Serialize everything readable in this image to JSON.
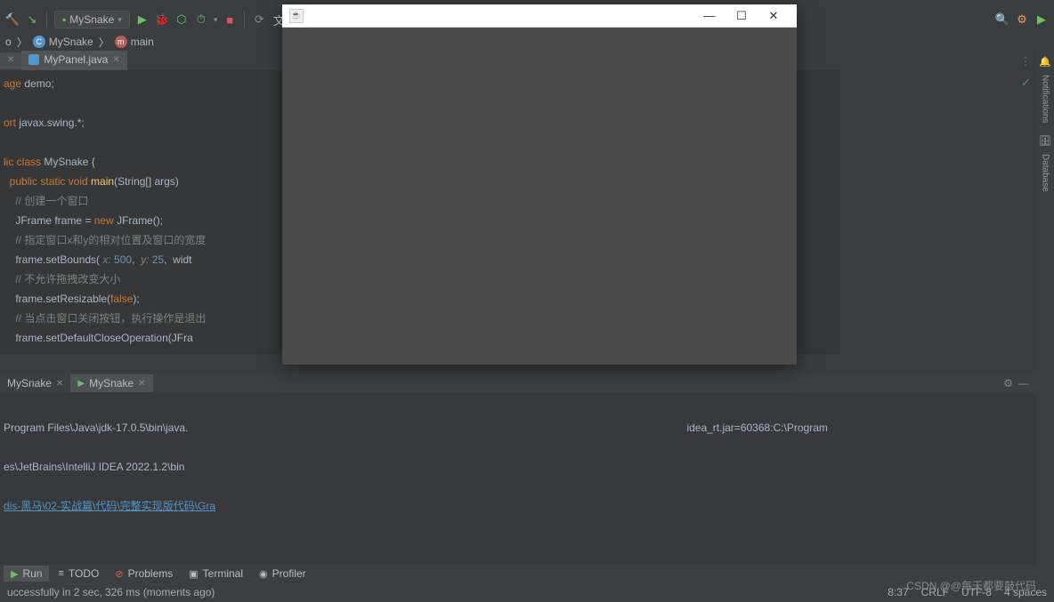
{
  "toolbar": {
    "run_config": "MySnake"
  },
  "breadcrumb": {
    "item1": "o",
    "item2": "MySnake",
    "item3": "main"
  },
  "tabs": {
    "file1": "MyPanel.java"
  },
  "code": {
    "l1a": "age ",
    "l1b": "demo",
    "l1c": ";",
    "l2a": "ort ",
    "l2b": "javax.swing.*",
    "l2c": ";",
    "l3a": "lic class ",
    "l3b": "MySnake ",
    "l3c": "{",
    "l4a": "  public static void ",
    "l4b": "main",
    "l4c": "(",
    "l4d": "String",
    "l4e": "[] ",
    "l4f": "args",
    "l4g": ")",
    "l5": "    // 创建一个窗口",
    "l6a": "    JFrame ",
    "l6b": "frame ",
    "l6c": "= ",
    "l6d": "new ",
    "l6e": "JFrame",
    "l6f": "();",
    "l7": "    // 指定窗口x和y的相对位置及窗口的宽度",
    "l8a": "    frame",
    "l8b": ".setBounds( ",
    "l8c": "x: ",
    "l8d": "500",
    "l8e": ",  ",
    "l8f": "y: ",
    "l8g": "25",
    "l8h": ",  ",
    "l8i": "widt",
    "l9": "    // 不允许拖拽改变大小",
    "l10a": "    frame",
    "l10b": ".setResizable(",
    "l10c": "false",
    "l10d": ");",
    "l11": "    // 当点击窗口关闭按钮，执行操作是退出",
    "l12a": "    frame",
    "l12b": ".setDefaultCloseOperation(JFra"
  },
  "run_tabs": {
    "t1": "MySnake",
    "t2": "MySnake"
  },
  "run_output": {
    "line1a": "Program Files\\Java\\jdk-17.0.5\\bin\\java.",
    "line1b": "idea_rt.jar=60368:C:\\Program",
    "line2": "es\\JetBrains\\IntelliJ IDEA 2022.1.2\\bin",
    "line3": "dis-黑马\\02-实战篇\\代码\\完整实现版代码\\Gra"
  },
  "bottom_tabs": {
    "run": "Run",
    "todo": "TODO",
    "problems": "Problems",
    "terminal": "Terminal",
    "profiler": "Profiler"
  },
  "status": {
    "left": "uccessfully in 2 sec, 326 ms (moments ago)",
    "pos": "8:37",
    "eol": "CRLF",
    "enc": "UTF-8",
    "indent": "4 spaces"
  },
  "sidebar": {
    "notifications": "Notifications",
    "database": "Database"
  },
  "watermark": "CSDN @@每天都要敲代码",
  "app_window": {
    "title": ""
  }
}
